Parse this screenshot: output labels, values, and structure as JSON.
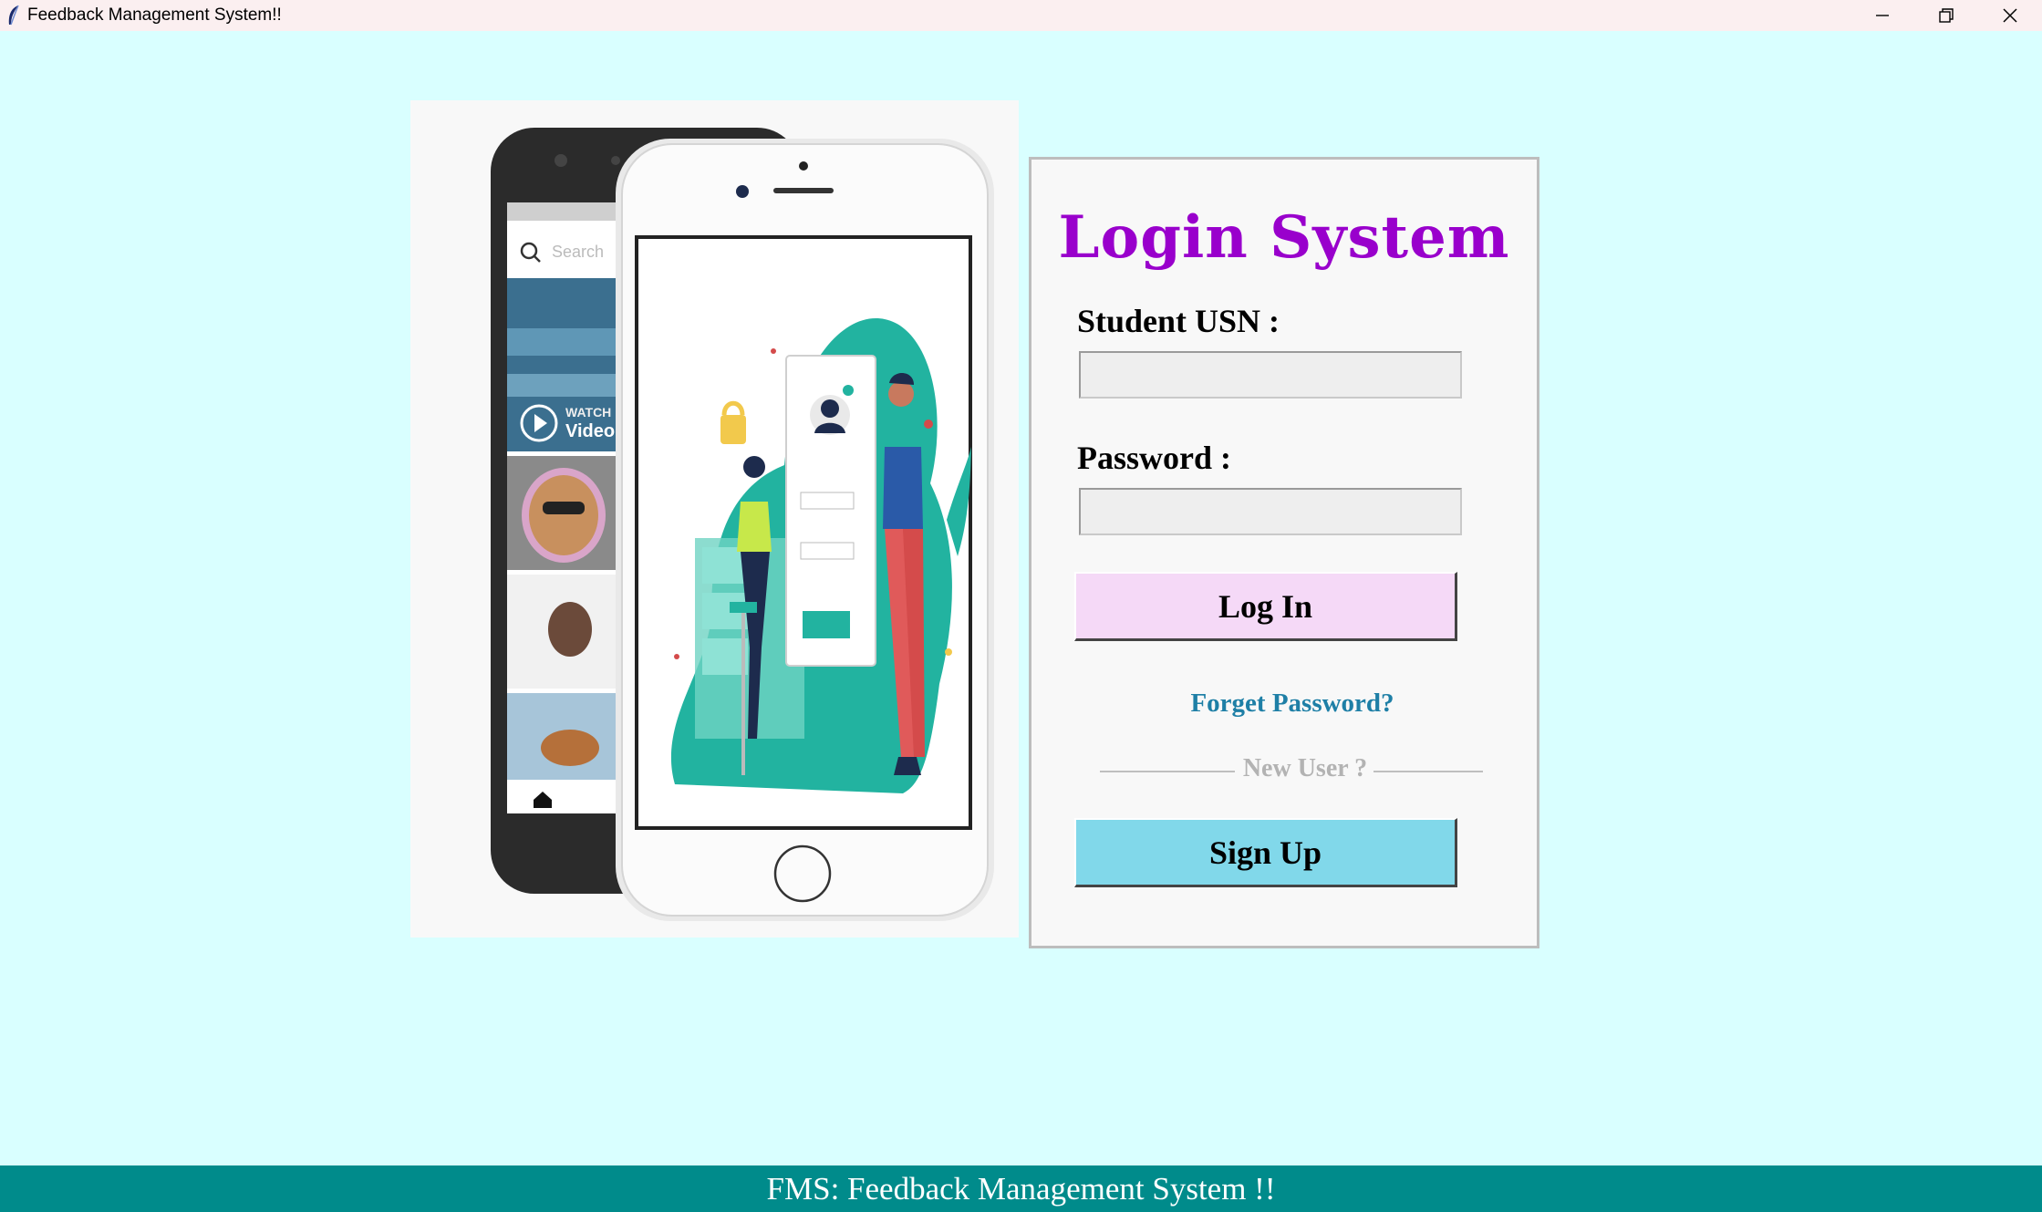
{
  "window": {
    "title": "Feedback Management System!!",
    "controls": [
      "minimize",
      "restore",
      "close"
    ]
  },
  "illustration": {
    "search_placeholder": "Search",
    "watch_line1": "WATCH",
    "watch_line2": "Video"
  },
  "login": {
    "heading": "Login System",
    "usn_label": "Student USN :",
    "usn_value": "",
    "password_label": "Password :",
    "password_value": "",
    "login_button": "Log In",
    "forgot_link": "Forget Password?",
    "new_user_text": "New User ?",
    "signup_button": "Sign Up"
  },
  "footer": {
    "text": "FMS: Feedback Management System !!"
  },
  "colors": {
    "background": "#d9ffff",
    "heading": "#9900cc",
    "login_button": "#f5d9f7",
    "signup_button": "#81d8ea",
    "link": "#1e7fa6",
    "footer": "#008b8b"
  }
}
